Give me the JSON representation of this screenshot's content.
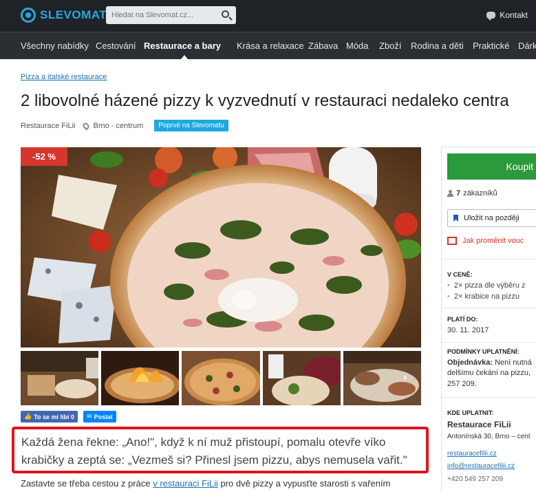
{
  "header": {
    "logo_text": "SLEVOMAT",
    "search_placeholder": "Hledat na Slevomat.cz...",
    "contact_label": "Kontakt"
  },
  "nav": {
    "items": [
      {
        "label": "Všechny nabídky",
        "active": false
      },
      {
        "label": "Cestování",
        "active": false
      },
      {
        "label": "Restaurace a bary",
        "active": true
      },
      {
        "label": "Krása a relaxace",
        "active": false
      },
      {
        "label": "Zábava",
        "active": false
      },
      {
        "label": "Móda",
        "active": false
      },
      {
        "label": "Zboží",
        "active": false
      },
      {
        "label": "Rodina a děti",
        "active": false
      },
      {
        "label": "Praktické",
        "active": false
      },
      {
        "label": "Dárk",
        "active": false
      }
    ]
  },
  "breadcrumb": "Pizza a italské restaurace",
  "title": "2 libovolné házené pizzy k vyzvednutí v restauraci nedaleko centra",
  "meta": {
    "restaurant": "Restaurace FiLii",
    "location": "Brno - centrum",
    "badge": "Poprvé na Slevomatu"
  },
  "discount": "-52 %",
  "social": {
    "like_label": "To se mi líbí 0",
    "send_label": "Poslat"
  },
  "quote": "Každá žena řekne: „Ano!\", když k ní muž přistoupí, pomalu otevře víko krabičky a zeptá se: „Vezmeš si? Přinesl jsem pizzu, abys nemusela vařit.\"",
  "intro": {
    "before": "Zastavte se třeba cestou z práce ",
    "link": "v restauraci FiLii",
    "after": " pro dvě pizzy a vypusťte starosti s vařením"
  },
  "sidebar": {
    "buy_label": "Koupit z",
    "customers_count": "7",
    "customers_label": "zákazníků",
    "save_label": "Uložit na později",
    "gift_label": "Jak proměnit vouc",
    "price_includes_head": "V CENĚ:",
    "price_includes": [
      "2× pizza dle výběru z",
      "2× krabice na pizzu"
    ],
    "valid_head": "PLATÍ DO:",
    "valid_date": "30. 11. 2017",
    "conditions_head": "PODMÍNKY UPLATNĚNÍ:",
    "conditions_lines": [
      {
        "bold": "Objednávka:",
        "text": " Není nutná"
      },
      {
        "bold": "",
        "text": "delšímu čekání na pizzu,"
      },
      {
        "bold": "",
        "text": "257 209."
      }
    ],
    "where_head": "KDE UPLATNIT:",
    "where_name": "Restaurace FiLii",
    "where_address": "Antonínská 30, Brno – cent",
    "where_web": "restauracefilii.cz",
    "where_email": "info@restauracefilii.cz",
    "where_phone": "+420 549 257 209"
  }
}
